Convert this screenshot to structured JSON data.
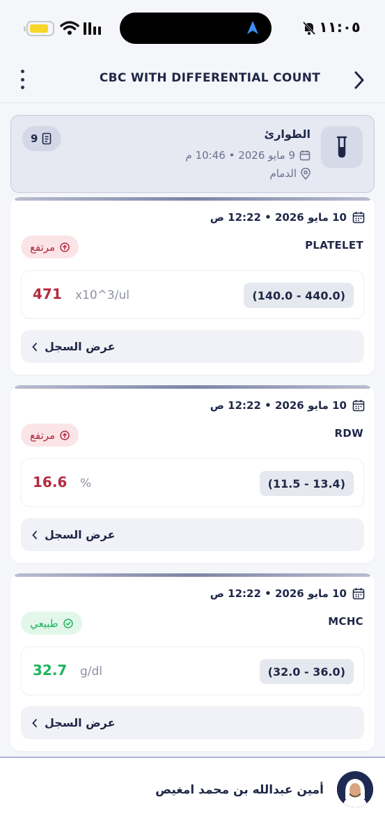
{
  "status_bar": {
    "time": "١١:٠٥",
    "battery_color": "#f7d62a"
  },
  "header": {
    "title": "CBC WITH DIFFERENTIAL COUNT"
  },
  "encounter": {
    "department": "الطوارئ",
    "date_time": "9 مايو 2026 • 10:46 م",
    "location": "الدمام",
    "count": "9"
  },
  "results": [
    {
      "date_time": "10 مايو 2026 • 12:22 ص",
      "name": "PLATELET",
      "status": "high",
      "status_label": "مرتفع",
      "value": "471",
      "unit": "x10^3/ul",
      "range": "(140.0 - 440.0)",
      "history_label": "عرض السجل"
    },
    {
      "date_time": "10 مايو 2026 • 12:22 ص",
      "name": "RDW",
      "status": "high",
      "status_label": "مرتفع",
      "value": "16.6",
      "unit": "%",
      "range": "(11.5 - 13.4)",
      "history_label": "عرض السجل"
    },
    {
      "date_time": "10 مايو 2026 • 12:22 ص",
      "name": "MCHC",
      "status": "normal",
      "status_label": "طبيعي",
      "value": "32.7",
      "unit": "g/dl",
      "range": "(32.0 - 36.0)",
      "history_label": "عرض السجل"
    }
  ],
  "footer": {
    "user_name": "أمين عبدالله بن محمد امغيص"
  },
  "colors": {
    "high": "#b32b3f",
    "normal": "#1eb45b",
    "primary": "#1f2747"
  }
}
